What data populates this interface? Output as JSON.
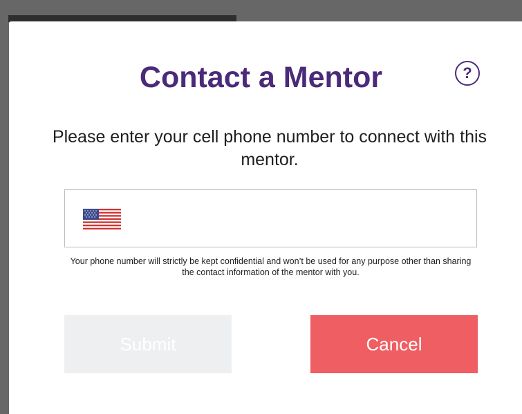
{
  "dialog": {
    "title": "Contact a Mentor",
    "help_icon": "question-circle-icon",
    "help_glyph": "?",
    "instruction": "Please enter your cell phone number to connect with this mentor.",
    "phone_field": {
      "country": "United States",
      "flag_icon": "us-flag-icon",
      "value": "",
      "placeholder": ""
    },
    "disclaimer": "Your phone number will strictly be kept confidential and won’t be used for any purpose other than sharing the contact information of the mentor with you.",
    "submit_label": "Submit",
    "cancel_label": "Cancel"
  },
  "colors": {
    "title": "#4b2a7a",
    "submit_bg_disabled": "#eeeff1",
    "cancel_bg": "#ef5e63",
    "overlay": "#676767"
  }
}
